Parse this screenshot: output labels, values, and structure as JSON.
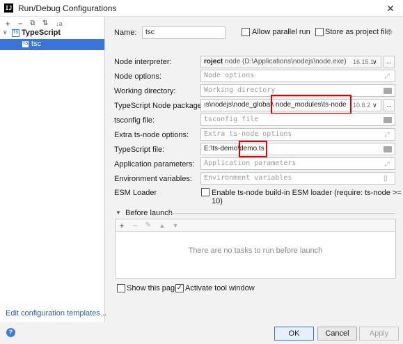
{
  "window": {
    "title": "Run/Debug Configurations",
    "app_icon": "IJ"
  },
  "toolbar": {
    "add": "+",
    "remove": "−",
    "copy": "⧉",
    "move": "⇅",
    "sort": "↓a"
  },
  "tree": {
    "root_label": "TypeScript",
    "child_label": "tsc",
    "icon_text": "TS"
  },
  "edit_templates_link": "Edit configuration templates...",
  "form": {
    "name_label": "Name:",
    "name_value": "tsc",
    "allow_parallel_label": "Allow parallel run",
    "store_project_label": "Store as project file",
    "node_interpreter_label": "Node interpreter:",
    "node_interpreter_value": "roject",
    "node_interpreter_path": "node (D:\\Applications\\nodejs\\node.exe)",
    "node_interpreter_version": "16.15.1",
    "node_options_label": "Node options:",
    "node_options_placeholder": "Node options",
    "working_dir_label": "Working directory:",
    "working_dir_placeholder": "Working directory",
    "ts_node_package_label": "TypeScript Node package:",
    "ts_node_package_prefix": "ıs\\nodejs\\node_global\\",
    "ts_node_package_highlight": "node_modules\\ts-node",
    "ts_node_package_version": "10.8.2",
    "tsconfig_label": "tsconfig file:",
    "tsconfig_placeholder": "tsconfig file",
    "extra_options_label": "Extra ts-node options:",
    "extra_options_placeholder": "Extra ts-node options",
    "ts_file_label": "TypeScript file:",
    "ts_file_prefix": "E:\\ts-demo\\",
    "ts_file_highlight": "demo.ts",
    "app_params_label": "Application parameters:",
    "app_params_placeholder": "Application parameters",
    "env_vars_label": "Environment variables:",
    "env_vars_placeholder": "Environment variables",
    "esm_label": "ESM Loader",
    "esm_checkbox_label": "Enable ts-node build-in ESM loader (require: ts-node >= 10)",
    "browse": "..."
  },
  "before_launch": {
    "header": "Before launch",
    "empty_text": "There are no tasks to run before launch",
    "toolbar": [
      "+",
      "−",
      "✎",
      "▲",
      "▼"
    ]
  },
  "footer": {
    "show_page_label": "Show this page",
    "activate_tool_label": "Activate tool window",
    "activate_checked": "✓",
    "ok": "OK",
    "cancel": "Cancel",
    "apply": "Apply",
    "help": "?"
  },
  "colors": {
    "selection": "#3875d7",
    "link": "#2a5db0",
    "highlight_box": "#e00000"
  }
}
